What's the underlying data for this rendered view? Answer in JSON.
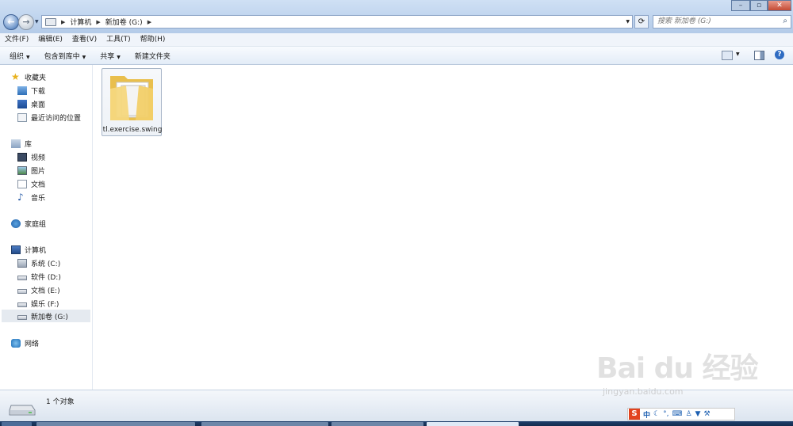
{
  "window": {
    "address": {
      "segments": [
        "计算机",
        "新加卷 (G:)"
      ]
    },
    "search": {
      "placeholder": "搜索 新加卷 (G:)"
    }
  },
  "menu": [
    "文件(F)",
    "编辑(E)",
    "查看(V)",
    "工具(T)",
    "帮助(H)"
  ],
  "toolbar": {
    "organize": "组织",
    "include_library": "包含到库中",
    "share": "共享",
    "new_folder": "新建文件夹"
  },
  "sidebar": {
    "favorites": {
      "label": "收藏夹",
      "items": [
        "下载",
        "桌面",
        "最近访问的位置"
      ]
    },
    "libraries": {
      "label": "库",
      "items": [
        "视频",
        "图片",
        "文档",
        "音乐"
      ]
    },
    "homegroup": "家庭组",
    "computer": {
      "label": "计算机",
      "drives": [
        "系统 (C:)",
        "软件 (D:)",
        "文档 (E:)",
        "娱乐 (F:)",
        "新加卷 (G:)"
      ],
      "selected_index": 4
    },
    "network": "网络"
  },
  "content": {
    "items": [
      {
        "name": "tl.exercise.swing",
        "type": "folder"
      }
    ]
  },
  "status": {
    "count": "1 个对象"
  },
  "ime": {
    "logo": "S",
    "lang": "中"
  },
  "watermark": {
    "brand": "Bai du 经验",
    "url": "jingyan.baidu.com"
  },
  "icons": {
    "back": "arrow-left",
    "forward": "arrow-right",
    "refresh": "refresh",
    "search": "magnifier",
    "view": "view-options",
    "preview": "preview-pane",
    "help": "question-mark"
  },
  "colors": {
    "titlebar": "#bfd4ee",
    "selection": "#e5eaf0",
    "folder": "#f2d06b",
    "ime_logo": "#e2431f"
  }
}
